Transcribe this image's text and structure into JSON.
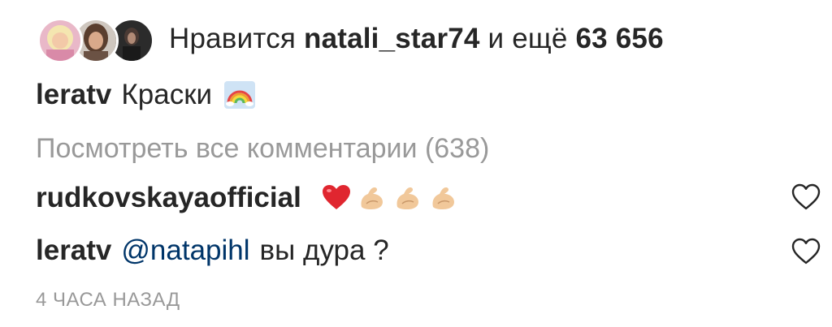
{
  "likes": {
    "prefix": "Нравится",
    "user": "natali_star74",
    "middle": "и ещё",
    "count": "63 656",
    "avatars": [
      "avatar-blonde-woman",
      "avatar-dark-hair-woman",
      "avatar-dark-figure"
    ]
  },
  "caption": {
    "username": "leratv",
    "text": "Краски",
    "emoji": "rainbow-emoji"
  },
  "view_all": {
    "label": "Посмотреть все комментарии (638)"
  },
  "comments": [
    {
      "username": "rudkovskayaofficial",
      "mention": "",
      "text": "",
      "emojis": [
        "red-heart-emoji",
        "flexed-biceps-emoji",
        "flexed-biceps-emoji",
        "flexed-biceps-emoji"
      ]
    },
    {
      "username": "leratv",
      "mention": "@natapihl",
      "text": "вы дура ?",
      "emojis": []
    }
  ],
  "timestamp": "4 ЧАСА НАЗАД",
  "colors": {
    "text": "#262626",
    "muted": "#999999",
    "mention": "#003569",
    "heart_outline": "#262626"
  }
}
